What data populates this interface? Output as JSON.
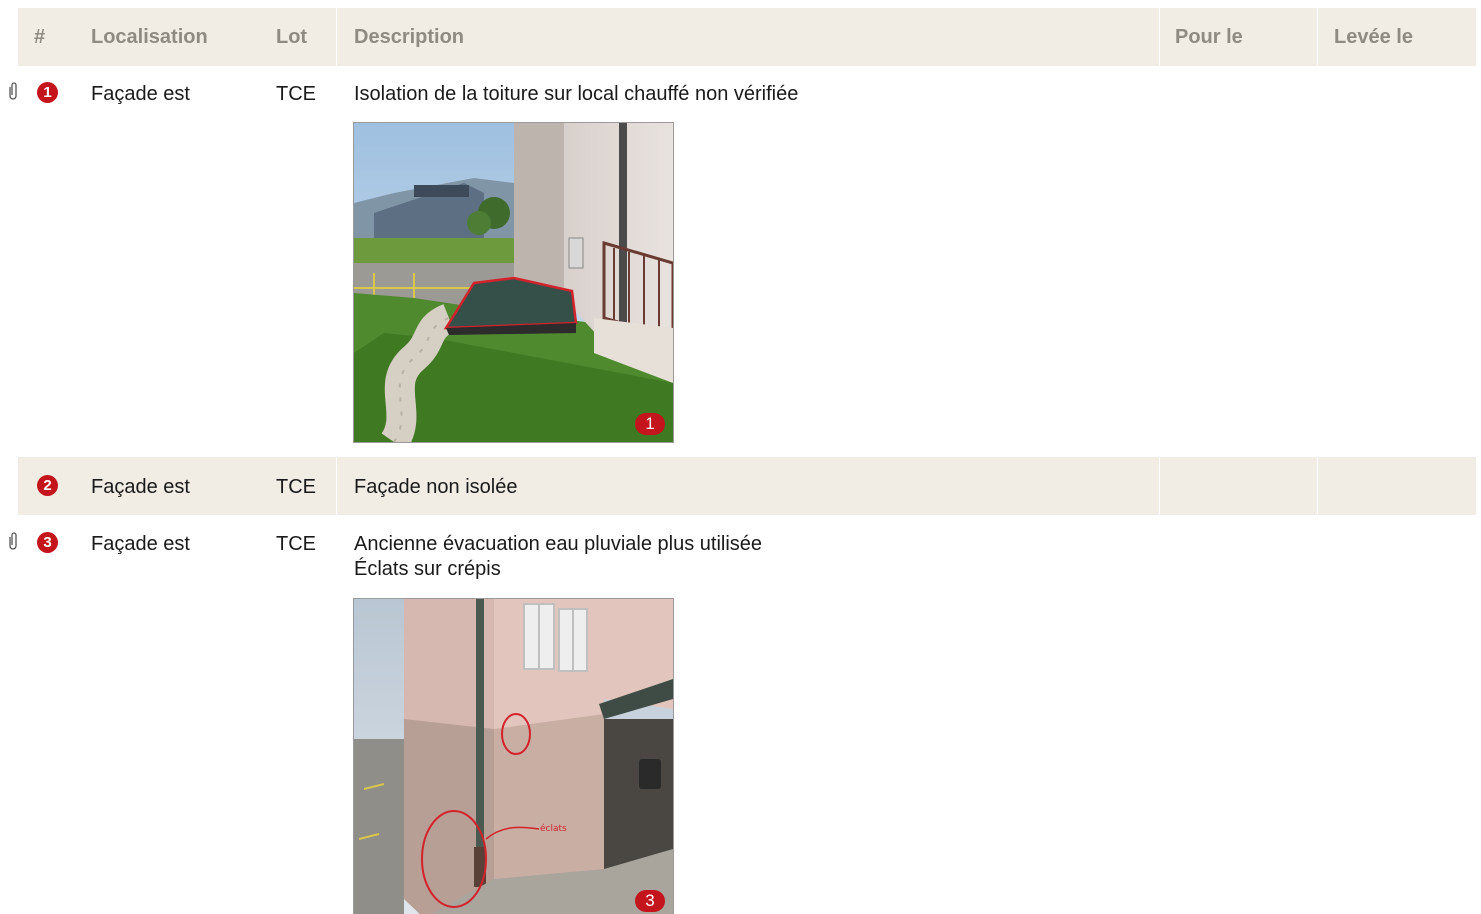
{
  "header": {
    "num": "#",
    "localisation": "Localisation",
    "lot": "Lot",
    "description": "Description",
    "pour_le": "Pour le",
    "levee_le": "Levée le"
  },
  "rows": [
    {
      "number": "1",
      "localisation": "Façade est",
      "lot": "TCE",
      "description_lines": [
        "Isolation de la toiture sur local chauffé non vérifiée"
      ],
      "has_attachment": true,
      "photo_badge": "1"
    },
    {
      "number": "2",
      "localisation": "Façade est",
      "lot": "TCE",
      "description_lines": [
        "Façade non isolée"
      ],
      "has_attachment": false
    },
    {
      "number": "3",
      "localisation": "Façade est",
      "lot": "TCE",
      "description_lines": [
        "Ancienne évacuation eau pluviale plus utilisée",
        "Éclats sur crépis"
      ],
      "has_attachment": true,
      "photo_badge": "3"
    }
  ],
  "icons": {
    "attachment": "paperclip-icon"
  },
  "colors": {
    "header_bg": "#f1ede4",
    "badge_red": "#c4141c",
    "header_text": "#8f8a82"
  }
}
